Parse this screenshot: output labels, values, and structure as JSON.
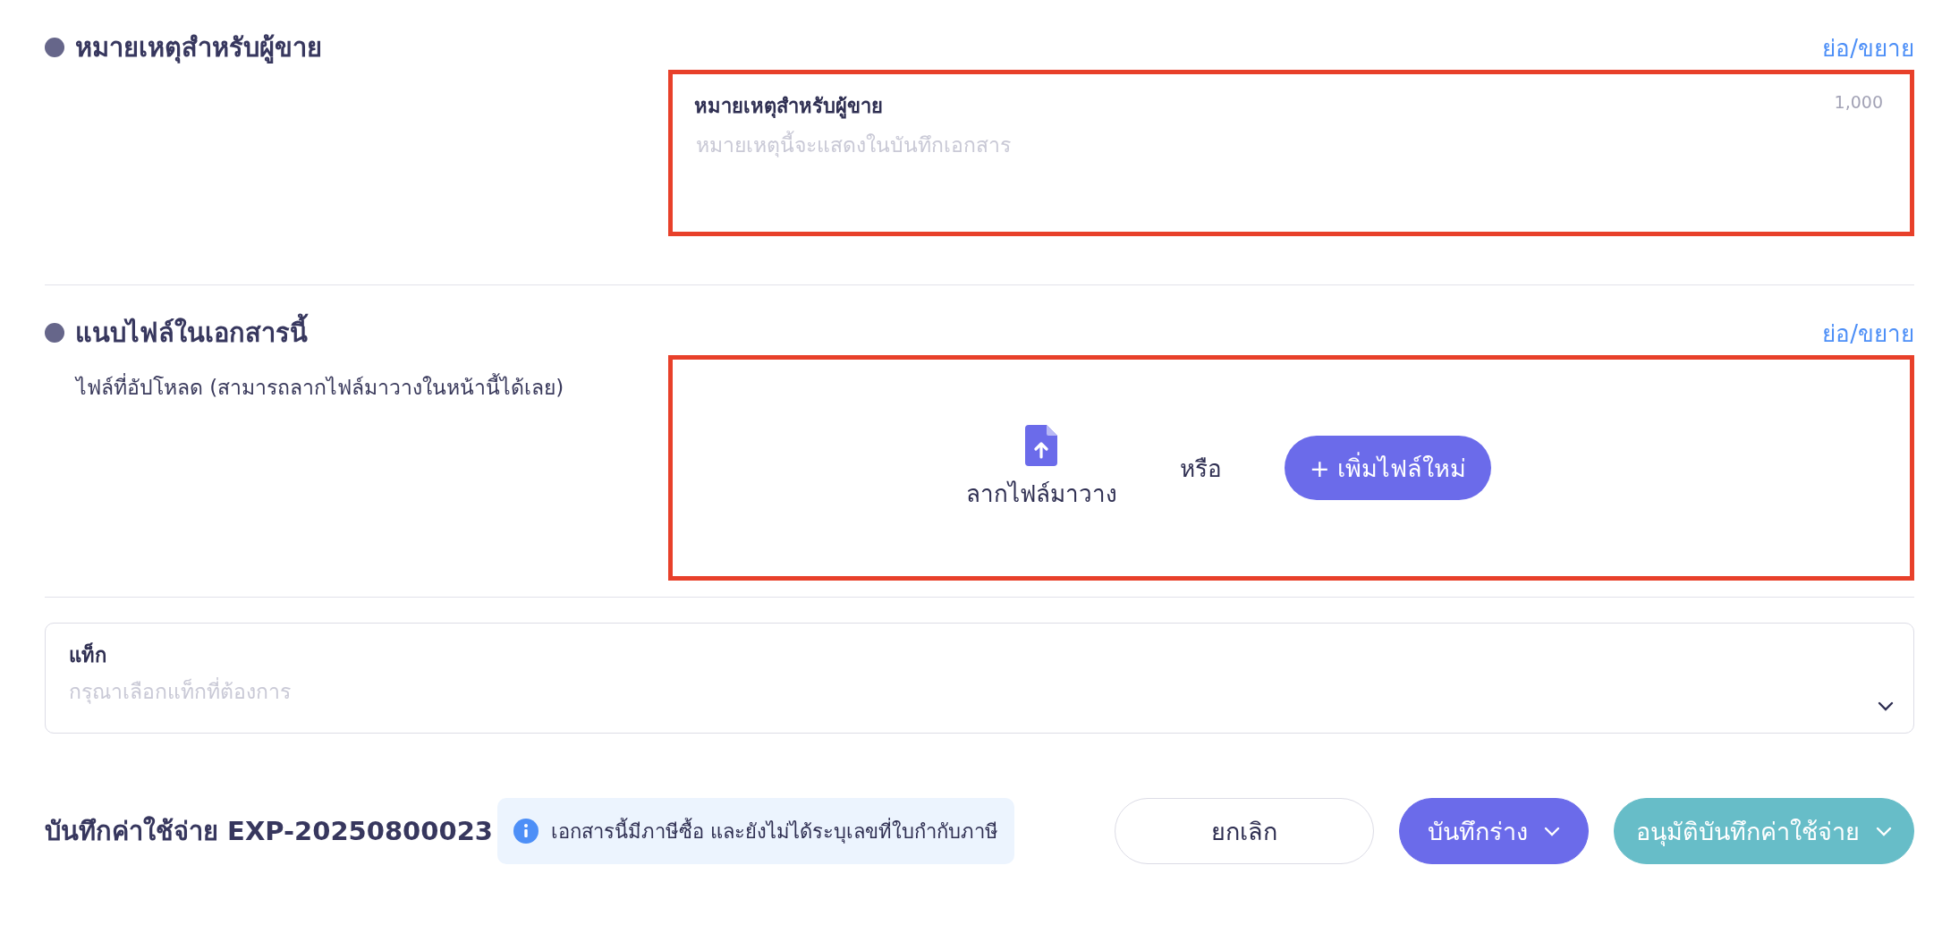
{
  "sections": [
    {
      "title": "หมายเหตุสำหรับผู้ขาย",
      "toggle": "ย่อ/ขยาย",
      "kind": "note",
      "highlighted": true,
      "field": {
        "label": "หมายเหตุสำหรับผู้ขาย",
        "placeholder": "หมายเหตุนี้จะแสดงในบันทึกเอกสาร",
        "counter": "1,000"
      }
    },
    {
      "title": "แนบไฟล์ในเอกสารนี้",
      "toggle": "ย่อ/ขยาย",
      "kind": "upload",
      "highlighted": true,
      "hint": "ไฟล์ที่อัปโหลด (สามารถลากไฟล์มาวางในหน้านี้ได้เลย)",
      "drop_label": "ลากไฟล์มาวาง",
      "or": "หรือ",
      "add_button": "+ เพิ่มไฟล์ใหม่"
    }
  ],
  "tags": {
    "label": "แท็ก",
    "placeholder": "กรุณาเลือกแท็กที่ต้องการ"
  },
  "footer": {
    "title": "บันทึกค่าใช้จ่าย EXP-20250800023",
    "notice": "เอกสารนี้มีภาษีซื้อ และยังไม่ได้ระบุเลขที่ใบกำกับภาษี",
    "buttons": [
      {
        "label": "ยกเลิก",
        "kind": "outline"
      },
      {
        "label": "บันทึกร่าง",
        "kind": "primary"
      },
      {
        "label": "อนุมัติบันทึกค่าใช้จ่าย",
        "kind": "teal"
      }
    ]
  }
}
